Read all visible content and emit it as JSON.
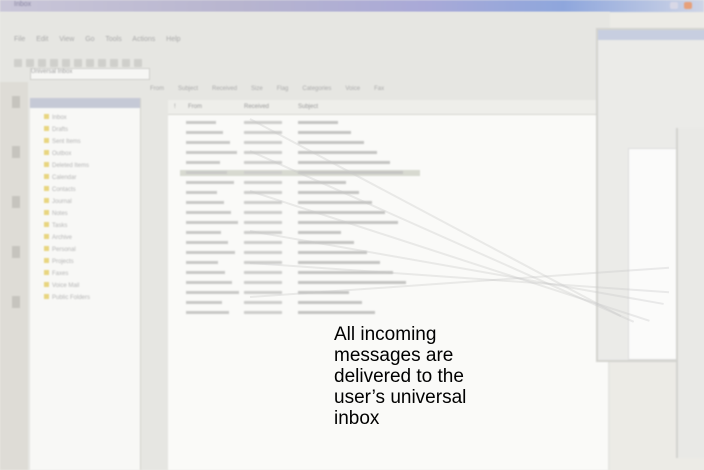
{
  "app": {
    "title_bar_text": "Inbox",
    "menu": "File Edit View Go Tools Actions Help",
    "address": "Universal Inbox"
  },
  "folders": [
    "Inbox",
    "Drafts",
    "Sent Items",
    "Outbox",
    "Deleted Items",
    "Calendar",
    "Contacts",
    "Journal",
    "Notes",
    "Tasks",
    "Archive",
    "Personal",
    "Projects",
    "Faxes",
    "Voice Mail",
    "Public Folders"
  ],
  "view_tabs": [
    "From",
    "Subject",
    "Received",
    "Size",
    "Flag",
    "Categories",
    "Voice",
    "Fax"
  ],
  "columns": [
    "!",
    "From",
    "Subject",
    "Received"
  ],
  "messages": [
    {
      "from": "",
      "subject": "",
      "date": ""
    },
    {
      "from": "",
      "subject": "",
      "date": ""
    },
    {
      "from": "",
      "subject": "",
      "date": ""
    },
    {
      "from": "",
      "subject": "",
      "date": ""
    },
    {
      "from": "",
      "subject": "",
      "date": ""
    },
    {
      "from": "",
      "subject": "",
      "date": ""
    },
    {
      "from": "",
      "subject": "",
      "date": ""
    },
    {
      "from": "",
      "subject": "",
      "date": ""
    },
    {
      "from": "",
      "subject": "",
      "date": ""
    },
    {
      "from": "",
      "subject": "",
      "date": ""
    },
    {
      "from": "",
      "subject": "",
      "date": ""
    },
    {
      "from": "",
      "subject": "",
      "date": ""
    },
    {
      "from": "",
      "subject": "",
      "date": ""
    },
    {
      "from": "",
      "subject": "",
      "date": ""
    },
    {
      "from": "",
      "subject": "",
      "date": ""
    },
    {
      "from": "",
      "subject": "",
      "date": ""
    },
    {
      "from": "",
      "subject": "",
      "date": ""
    },
    {
      "from": "",
      "subject": "",
      "date": ""
    },
    {
      "from": "",
      "subject": "",
      "date": ""
    },
    {
      "from": "",
      "subject": "",
      "date": ""
    }
  ],
  "callout": {
    "line1": "All incoming",
    "line2": "messages are",
    "line3": "delivered to the",
    "line4": "user’s universal",
    "line5": "inbox"
  },
  "colors": {
    "title_bar": "#a9a9d7",
    "selection": "#d7d9d0",
    "folder_icon": "#e8d57e"
  }
}
